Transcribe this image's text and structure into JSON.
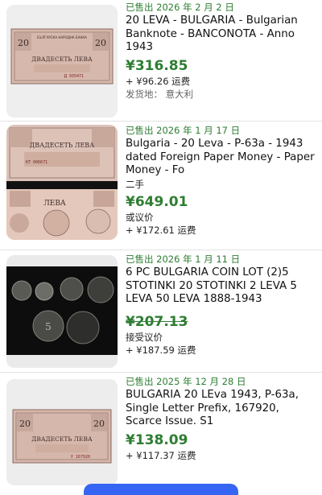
{
  "listings": [
    {
      "sold_date": "已售出 2026 年 2 月 2 日",
      "title": "20 LEVA - BULGARIA - Bulgarian Banknote - BANCONOTA -  Anno 1943",
      "price": "¥316.85",
      "extra1": "",
      "shipping": "+ ¥96.26 运费",
      "location": "发货地： 意大利"
    },
    {
      "sold_date": "已售出 2026 年 1 月 17 日",
      "title": "Bulgaria - 20 Leva - P-63a - 1943 dated Foreign Paper Money - Paper Money - Fo",
      "condition": "二手",
      "price": "¥649.01",
      "offer": "或议价",
      "shipping": "+ ¥172.61 运费"
    },
    {
      "sold_date": "已售出 2026 年 1 月 11 日",
      "title": "6 PC BULGARIA COIN LOT (2)5 STOTINKI 20 STOTINKI 2 LEVA 5 LEVA 50 LEVA 1888-1943",
      "price": "¥207.13",
      "offer": "接受议价",
      "shipping": "+ ¥187.59 运费"
    },
    {
      "sold_date": "已售出 2025 年 12 月 28 日",
      "title": "BULGARIA 20 LEva 1943, P-63a, Single Letter Prefix, 167920, Scarce Issue. S1",
      "price": "¥138.09",
      "shipping": "+ ¥117.37 运费"
    }
  ],
  "banknote": {
    "top_text": "БЪЛГАРСКА НАРОДНА БАНКА",
    "denomination": "20",
    "words": "ДВАДЕСЕТЬ ЛЕВА",
    "serial1": "Д 935471",
    "serial2": "КТ 006671",
    "serial4": "У 167920",
    "back_text": "ЛЕВА"
  },
  "coins": {
    "mark": "5"
  }
}
